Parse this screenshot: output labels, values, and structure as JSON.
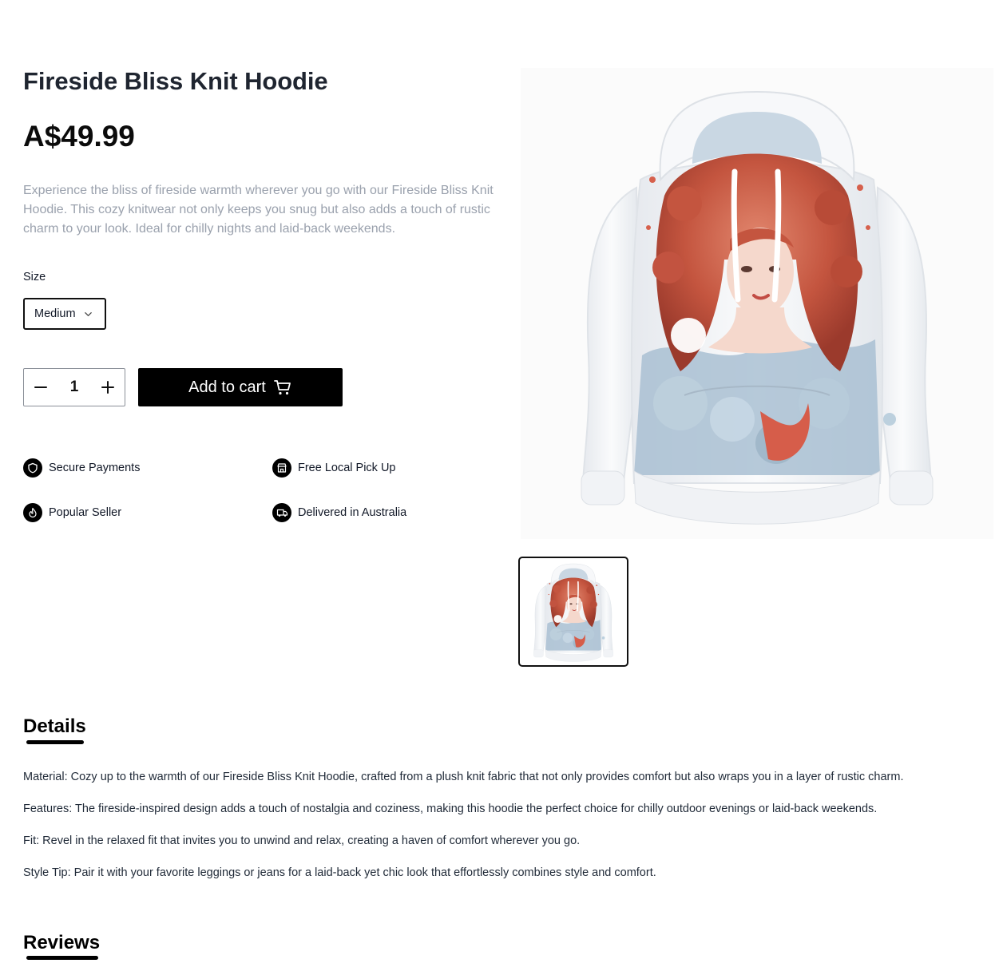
{
  "product": {
    "title": "Fireside Bliss Knit Hoodie",
    "price": "A$49.99",
    "description": "Experience the bliss of fireside warmth wherever you go with our Fireside Bliss Knit Hoodie. This cozy knitwear not only keeps you snug but also adds a touch of rustic charm to your look. Ideal for chilly nights and laid-back weekends."
  },
  "size": {
    "label": "Size",
    "selected": "Medium"
  },
  "quantity": {
    "value": "1"
  },
  "cart": {
    "add_label": "Add to cart"
  },
  "features": [
    {
      "label": "Secure Payments",
      "icon": "shield-icon"
    },
    {
      "label": "Free Local Pick Up",
      "icon": "store-icon"
    },
    {
      "label": "Popular Seller",
      "icon": "flame-icon"
    },
    {
      "label": "Delivered in Australia",
      "icon": "truck-icon"
    }
  ],
  "details": {
    "heading": "Details",
    "lines": [
      "Material: Cozy up to the warmth of our Fireside Bliss Knit Hoodie, crafted from a plush knit fabric that not only provides comfort but also wraps you in a layer of rustic charm.",
      "Features: The fireside-inspired design adds a touch of nostalgia and coziness, making this hoodie the perfect choice for chilly outdoor evenings or laid-back weekends.",
      "Fit: Revel in the relaxed fit that invites you to unwind and relax, creating a haven of comfort wherever you go.",
      "Style Tip: Pair it with your favorite leggings or jeans for a laid-back yet chic look that effortlessly combines style and comfort."
    ]
  },
  "reviews": {
    "heading": "Reviews"
  },
  "colors": {
    "primary": "#000000",
    "description_text": "#9aa1ad",
    "hair": "#c4553f",
    "waves": "#9fb6c8"
  }
}
